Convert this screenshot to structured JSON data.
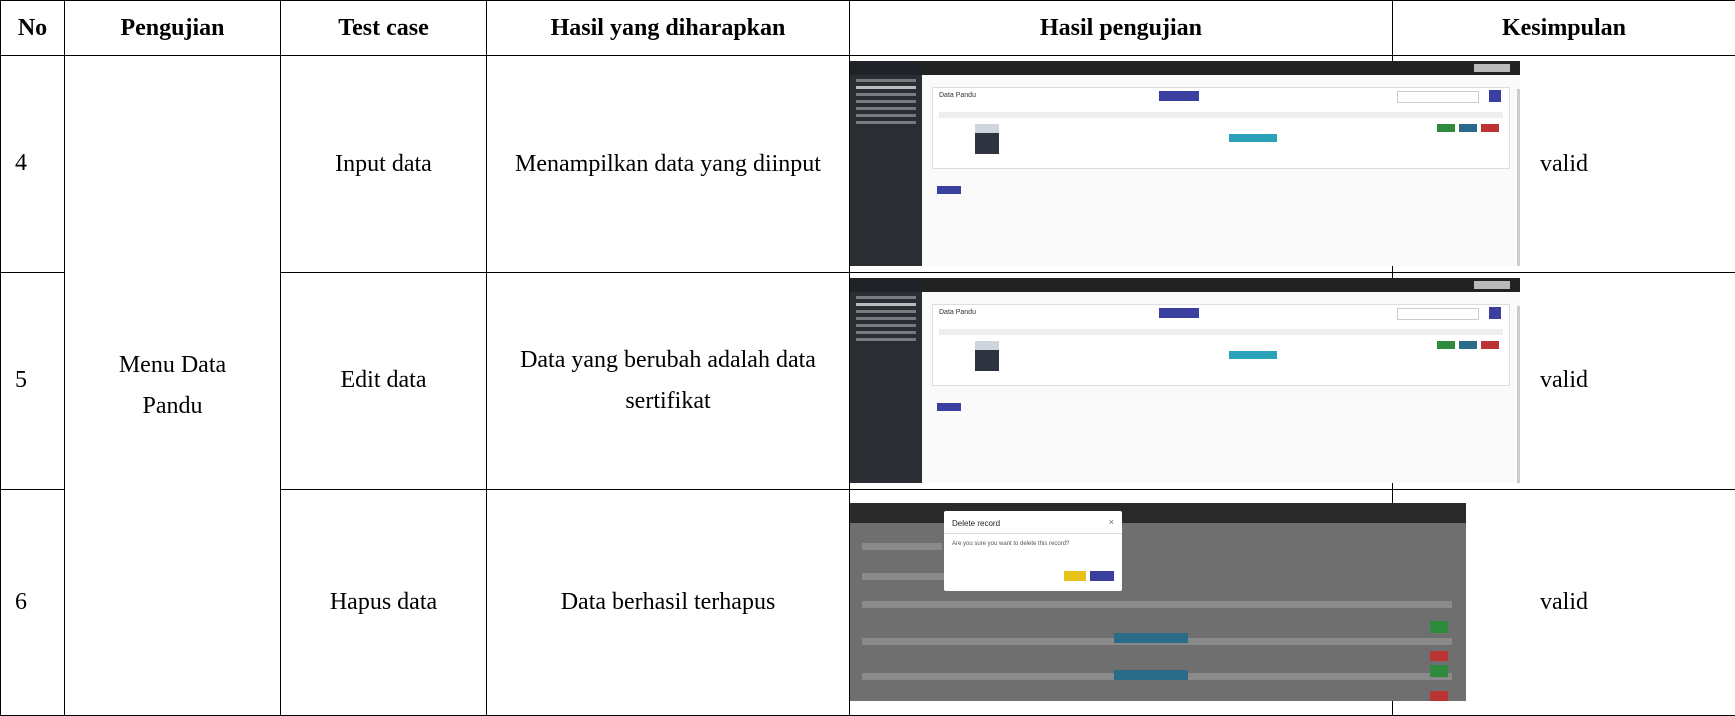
{
  "headers": [
    "No",
    "Pengujian",
    "Test case",
    "Hasil yang diharapkan",
    "Hasil pengujian",
    "Kesimpulan"
  ],
  "group_label_line1": "Menu Data",
  "group_label_line2": "Pandu",
  "rows": [
    {
      "no": "4",
      "test_case": "Input data",
      "expected_line1": "Menampilkan data yang diinput",
      "expected_line2": "",
      "conclusion": "valid"
    },
    {
      "no": "5",
      "test_case": "Edit data",
      "expected_line1": "Data yang berubah adalah data",
      "expected_line2": "sertifikat",
      "conclusion": "valid"
    },
    {
      "no": "6",
      "test_case": "Hapus data",
      "expected_line1": "Data berhasil terhapus",
      "expected_line2": "",
      "conclusion": "valid"
    }
  ],
  "screenshots": {
    "card_title": "Data Pandu",
    "modal_title": "Delete record",
    "modal_body": "Are you sure you want to delete this record?"
  },
  "colors": {
    "sidebar": "#2a2e33",
    "primary": "#3b3fa0",
    "info": "#2aa3b8",
    "success": "#2e8b3d",
    "danger": "#bb3333",
    "warning": "#e6c21a"
  }
}
